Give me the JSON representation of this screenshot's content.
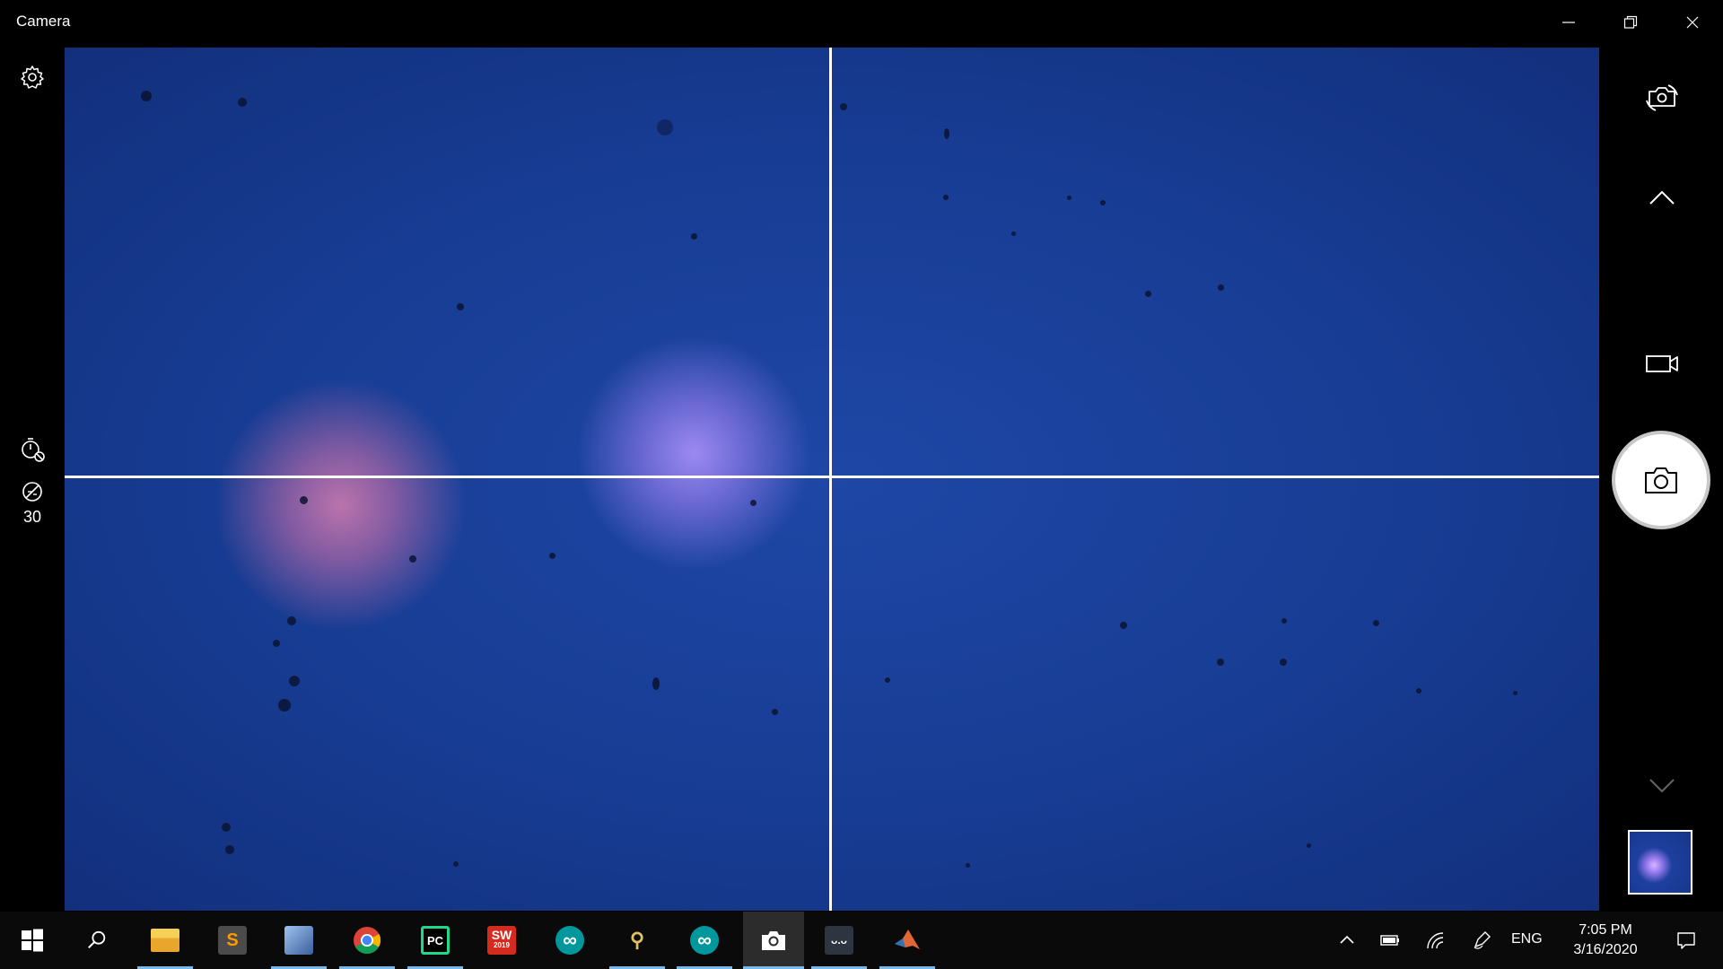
{
  "window": {
    "title": "Camera",
    "minimize_icon": "minimize-icon",
    "restore_icon": "restore-icon",
    "close_icon": "close-icon"
  },
  "left_rail": {
    "settings_icon": "gear-icon",
    "timer_icon": "timer-off-icon",
    "brightness_icon": "brightness-icon",
    "brightness_value": "30"
  },
  "viewfinder": {
    "grid": "2x2 framing grid"
  },
  "right_rail": {
    "switch_camera_icon": "switch-camera-icon",
    "mode_up_icon": "chevron-up-icon",
    "video_mode_icon": "video-camera-icon",
    "shutter_icon": "camera-icon",
    "mode_down_icon": "chevron-down-icon",
    "last_capture": "last-photo-thumbnail"
  },
  "taskbar": {
    "apps": [
      {
        "name": "start-icon",
        "label": ""
      },
      {
        "name": "search-icon",
        "label": ""
      },
      {
        "name": "file-explorer-icon",
        "label": ""
      },
      {
        "name": "sublime-text-icon",
        "label": "S"
      },
      {
        "name": "app-icon",
        "label": ""
      },
      {
        "name": "chrome-icon",
        "label": ""
      },
      {
        "name": "pycharm-icon",
        "label": "PC"
      },
      {
        "name": "solidworks-icon",
        "label": "SW",
        "sub": "2019"
      },
      {
        "name": "arduino-icon",
        "label": "∞"
      },
      {
        "name": "app-icon",
        "label": ""
      },
      {
        "name": "arduino-icon",
        "label": "∞"
      },
      {
        "name": "camera-icon",
        "label": ""
      },
      {
        "name": "app-icon",
        "label": ""
      },
      {
        "name": "matlab-icon",
        "label": ""
      }
    ],
    "tray": {
      "show_hidden_icon": "chevron-up-icon",
      "battery_icon": "battery-icon",
      "network_icon": "wifi-icon",
      "pen_icon": "pen-icon",
      "language": "ENG",
      "time": "7:05 PM",
      "date": "3/16/2020",
      "notification_icon": "notification-icon"
    }
  },
  "colors": {
    "viewfinder_blue": "#1a43a0",
    "accent_underline": "#76b9ed"
  }
}
